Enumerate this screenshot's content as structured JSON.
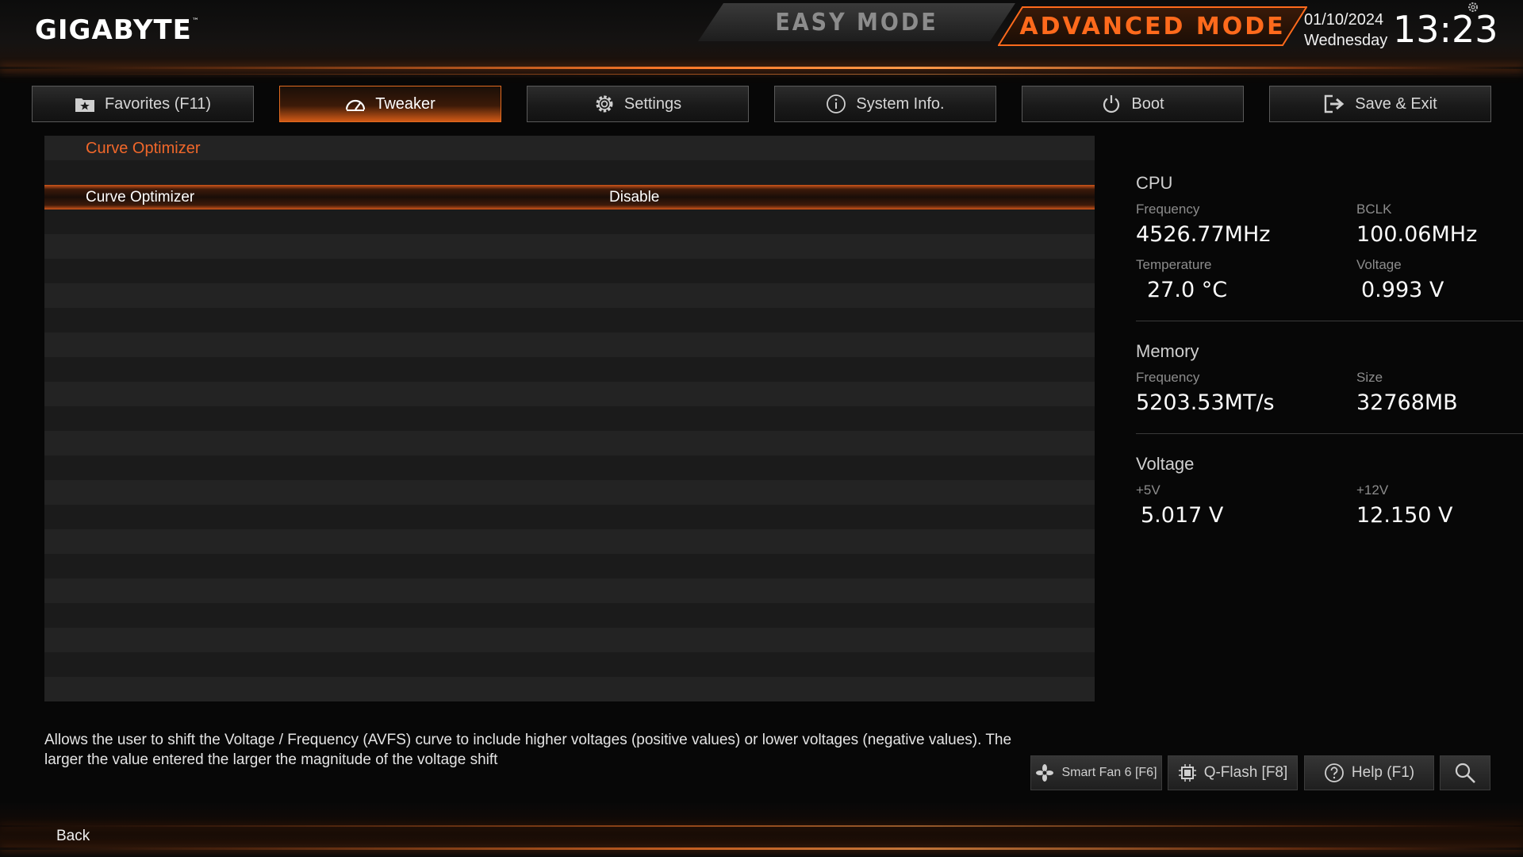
{
  "header": {
    "logo": "GIGABYTE",
    "logo_tm": "™",
    "easy_mode": "EASY MODE",
    "advanced_mode": "ADVANCED MODE",
    "date": "01/10/2024",
    "weekday": "Wednesday",
    "time": "13:23",
    "settings_icon": "gear-icon"
  },
  "tabs": [
    {
      "label": "Favorites (F11)",
      "icon": "star-folder-icon",
      "active": false
    },
    {
      "label": "Tweaker",
      "icon": "speedometer-icon",
      "active": true
    },
    {
      "label": "Settings",
      "icon": "gear-icon",
      "active": false
    },
    {
      "label": "System Info.",
      "icon": "info-icon",
      "active": false
    },
    {
      "label": "Boot",
      "icon": "power-icon",
      "active": false
    },
    {
      "label": "Save & Exit",
      "icon": "exit-icon",
      "active": false
    }
  ],
  "main": {
    "breadcrumb": "Curve Optimizer",
    "selected_item": {
      "label": "Curve Optimizer",
      "value": "Disable"
    }
  },
  "info": {
    "cpu": {
      "title": "CPU",
      "frequency_label": "Frequency",
      "frequency": "4526.77MHz",
      "bclk_label": "BCLK",
      "bclk": "100.06MHz",
      "temperature_label": "Temperature",
      "temperature": "27.0 °C",
      "voltage_label": "Voltage",
      "voltage": "0.993 V"
    },
    "memory": {
      "title": "Memory",
      "frequency_label": "Frequency",
      "frequency": "5203.53MT/s",
      "size_label": "Size",
      "size": "32768MB"
    },
    "voltage": {
      "title": "Voltage",
      "v5_label": "+5V",
      "v5": "5.017 V",
      "v12_label": "+12V",
      "v12": "12.150 V"
    }
  },
  "footer": {
    "description": "Allows the user to shift the Voltage / Frequency (AVFS) curve to include higher voltages (positive values) or lower voltages (negative values). The larger the value entered the larger the magnitude of the voltage shift",
    "smart_fan": "Smart Fan 6 [F6]",
    "qflash": "Q-Flash [F8]",
    "help": "Help (F1)",
    "back": "Back"
  },
  "colors": {
    "accent": "#ff6a1c",
    "breadcrumb": "#f0672a"
  }
}
